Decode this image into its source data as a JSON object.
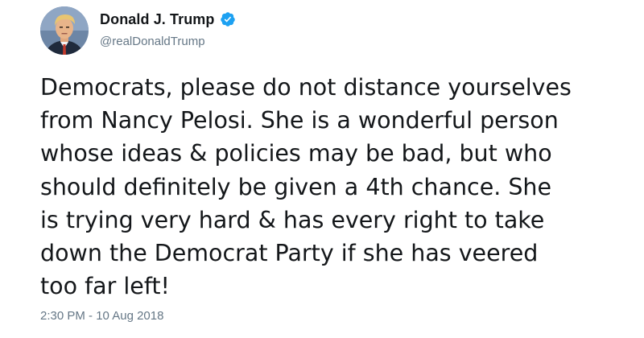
{
  "author": {
    "display_name": "Donald J. Trump",
    "handle": "@realDonaldTrump",
    "verified": true,
    "avatar_icon": "profile-photo",
    "verified_icon": "verified-badge-icon",
    "verified_color": "#1da1f2"
  },
  "tweet": {
    "lines": [
      "Democrats, please do not distance yourselves",
      "from Nancy Pelosi. She is a wonderful person",
      "whose ideas & policies may be bad, but who",
      "should definitely be given a 4th chance. She",
      "is trying very hard & has every right to take",
      "down the Democrat Party if she has veered",
      "too far left!"
    ],
    "timestamp": "2:30 PM - 10 Aug 2018"
  },
  "colors": {
    "text": "#14171a",
    "secondary": "#657786",
    "background": "#ffffff"
  }
}
